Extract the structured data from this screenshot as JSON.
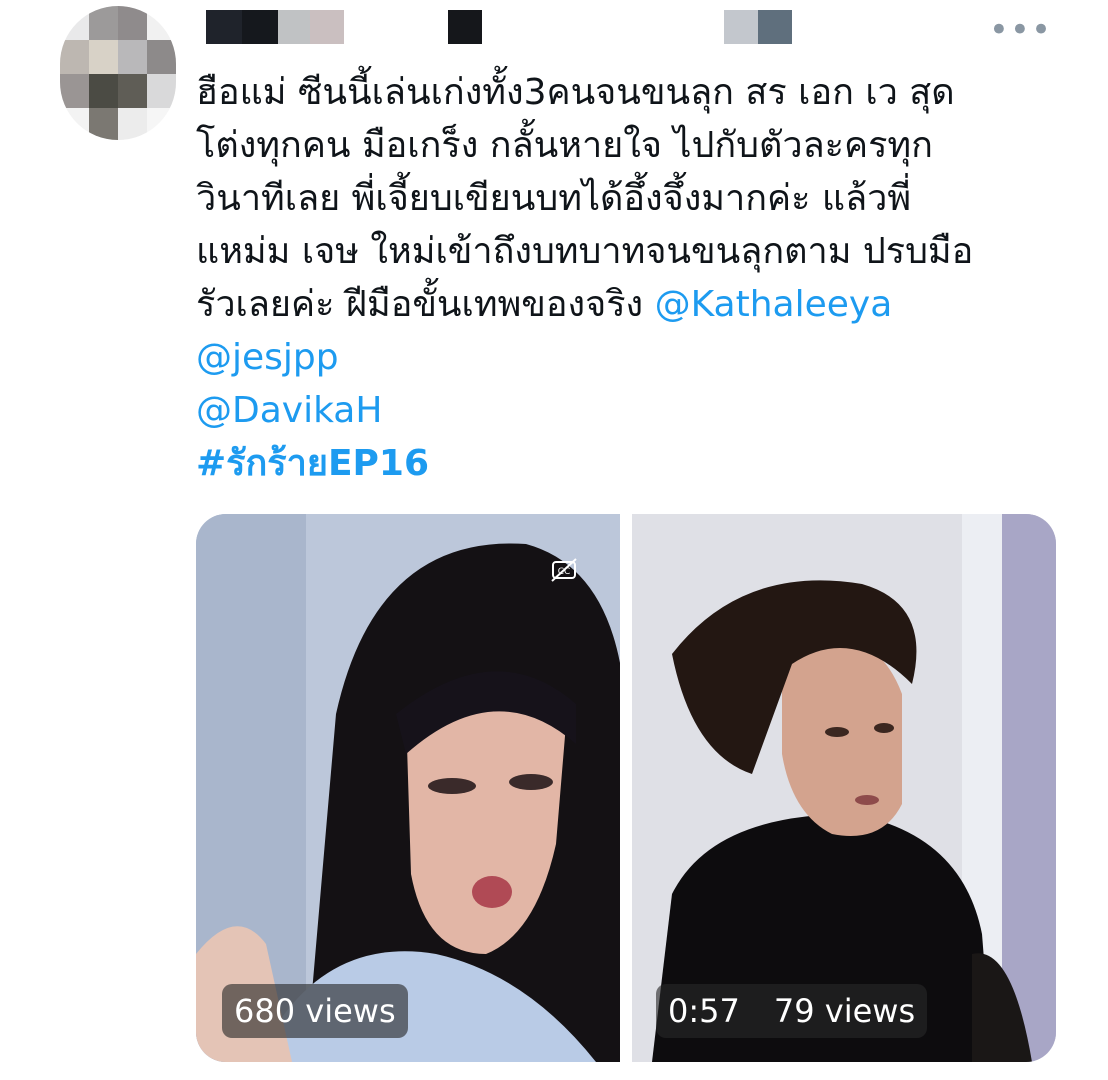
{
  "header": {
    "name_blocks": [
      {
        "color": "#1f232b",
        "w": 36
      },
      {
        "color": "#15181d",
        "w": 36
      },
      {
        "color": "#c0c2c4",
        "w": 32
      },
      {
        "color": "#cabfc0",
        "w": 34
      },
      {
        "color": "#ffffff",
        "w": 104
      },
      {
        "color": "#15171b",
        "w": 34
      },
      {
        "color": "#ffffff",
        "w": 242
      },
      {
        "color": "#c3c7cd",
        "w": 34
      },
      {
        "color": "#5f6f7d",
        "w": 34
      }
    ],
    "more_icon": "more-dots-icon",
    "more_glyph": "•••"
  },
  "tweet": {
    "lines": [
      "ฮือแม่ ซีนนี้เล่นเก่งทั้ง3คนจนขนลุก สร เอก เว สุด",
      "โต่งทุกคน มือเกร็ง กลั้นหายใจ ไปกับตัวละครทุก",
      "วินาทีเลย พี่เจี้ยบเขียนบทได้อึ้งจึ้งมากค่ะ แล้วพี่",
      "แหม่ม เจษ ใหม่เข้าถึงบทบาทจนขนลุกตาม ปรบมือ",
      "รัวเลยค่ะ ฝีมือขั้นเทพของจริง"
    ],
    "mentions": [
      "@Kathaleeya",
      "@jesjpp",
      "@DavikaH"
    ],
    "hashtag": "#รักร้ายEP16"
  },
  "media": [
    {
      "views": "680 views"
    },
    {
      "duration": "0:57",
      "views": "79 views"
    }
  ],
  "colors": {
    "link": "#1d9bf0",
    "text": "#0f1419"
  }
}
